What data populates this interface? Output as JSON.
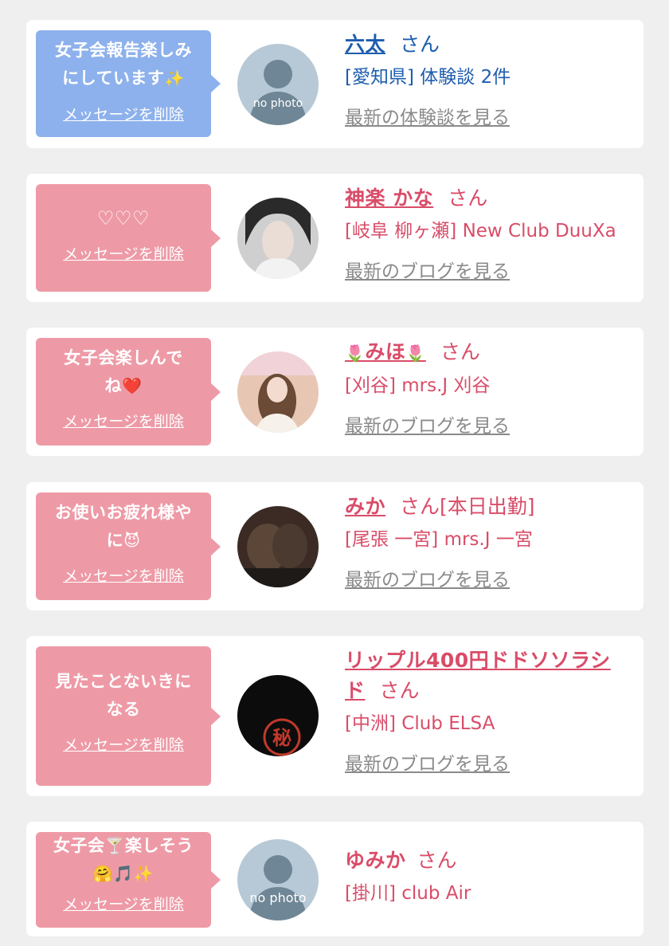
{
  "colors": {
    "card_bg": "#ffffff",
    "page_bg": "#efefef",
    "bubble_blue": "#8db1ec",
    "bubble_pink": "#ee9aa6",
    "name_blue": "#1d5dae",
    "name_pink": "#d94c68",
    "link_gray": "#8a8a8a"
  },
  "common": {
    "delete_label": "メッセージを削除",
    "san": "さん"
  },
  "entries": [
    {
      "message_line1": "女子会報告楽しみ",
      "message_line2": "にしています",
      "message_emoji": "✨",
      "name": "六太",
      "name_suffix": "",
      "shop": "[愛知県] 体験談 2件",
      "link": "最新の体験談を見る",
      "avatar_text": "no photo"
    },
    {
      "message_line1": "♡♡♡",
      "name": "神楽 かな",
      "shop": "[岐阜 柳ヶ瀬] New Club DuuXa",
      "link": "最新のブログを見る"
    },
    {
      "message_line1": "女子会楽しんで",
      "message_line2": "ね",
      "message_emoji": "❤️",
      "name_prefix_icon": "🌷",
      "name": "みほ",
      "name_suffix_icon": "🌷",
      "shop": "[刈谷] mrs.J 刈谷",
      "link": "最新のブログを見る"
    },
    {
      "message_line1": "お使いお疲れ様や",
      "message_line2": "に",
      "message_emoji": "😈",
      "name": "みか",
      "name_extra": "[本日出勤]",
      "shop": "[尾張 一宮] mrs.J 一宮",
      "link": "最新のブログを見る"
    },
    {
      "message_line1": "見たことないきに",
      "message_line2": "なる",
      "name_line1": "リップル400円ドドソソラシ",
      "name_line2": "ド",
      "shop": "[中洲] Club ELSA",
      "link": "最新のブログを見る",
      "avatar_text": "秘"
    },
    {
      "message_line1_a": "女子会",
      "message_line1_emoji": "🍸",
      "message_line1_b": "楽しそう",
      "message_line2": "🤗🎵✨",
      "name": "ゆみか",
      "shop": "[掛川] club Air",
      "avatar_text": "no photo"
    }
  ]
}
